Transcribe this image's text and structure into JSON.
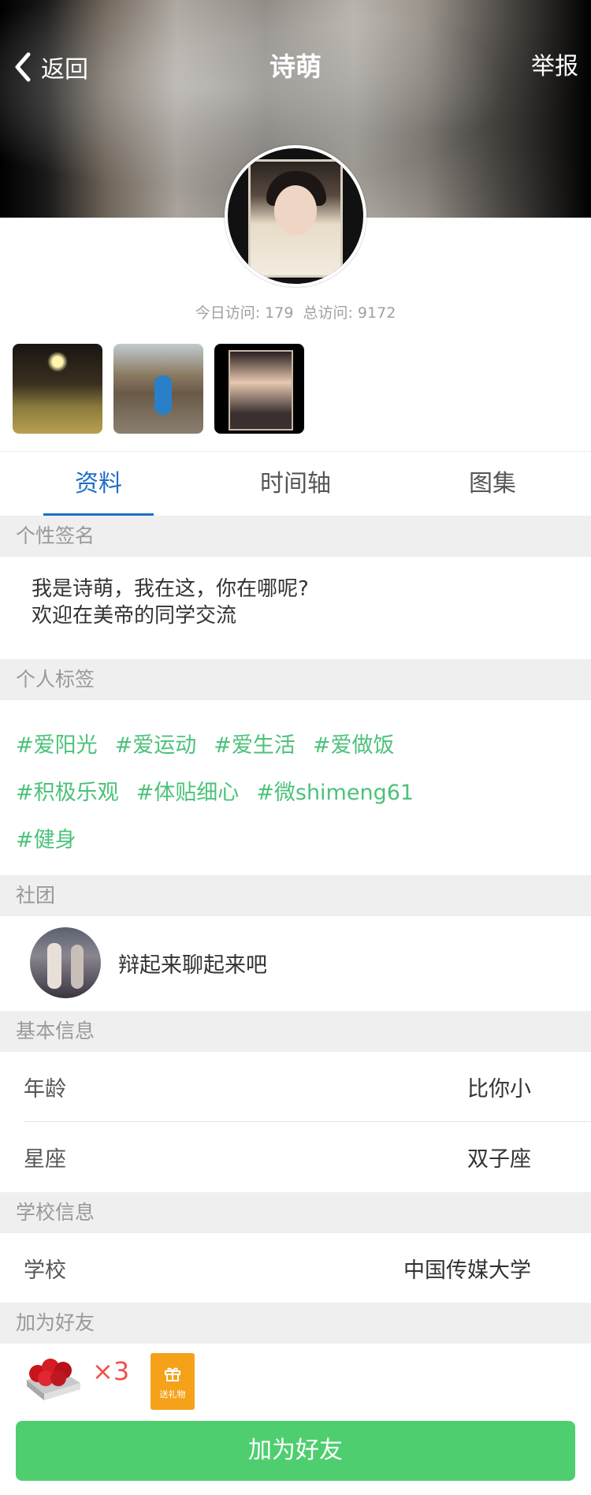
{
  "nav": {
    "back_label": "返回",
    "title": "诗萌",
    "report_label": "举报"
  },
  "visits": {
    "today": "今日访问: 179",
    "total": "总访问: 9172"
  },
  "tabs": [
    {
      "label": "资料"
    },
    {
      "label": "时间轴"
    },
    {
      "label": "图集"
    }
  ],
  "sections": {
    "signature": "个性签名",
    "tags": "个人标签",
    "club": "社团",
    "basic": "基本信息",
    "school": "学校信息",
    "add_friend": "加为好友"
  },
  "signature": {
    "line1": "我是诗萌，我在这，你在哪呢?",
    "line2": "欢迎在美帝的同学交流"
  },
  "tags": [
    "#爱阳光",
    "#爱运动",
    "#爱生活",
    "#爱做饭",
    "#积极乐观",
    "#体贴细心",
    "#微shimeng61",
    "#健身"
  ],
  "club": {
    "name": "辩起来聊起来吧"
  },
  "basic_info": [
    {
      "label": "年龄",
      "value": "比你小"
    },
    {
      "label": "星座",
      "value": "双子座"
    }
  ],
  "school_info": [
    {
      "label": "学校",
      "value": "中国传媒大学"
    }
  ],
  "gift": {
    "count": "×3",
    "button_label": "送礼物"
  },
  "add_friend_button": "加为好友",
  "colors": {
    "tab_active": "#1e6fc8",
    "tag": "#4bc27a",
    "primary_button": "#4fce70",
    "gift_button": "#f5a21a",
    "gift_count": "#f0524a"
  },
  "icons": {
    "back": "chevron-left-icon",
    "gift": "gift-icon",
    "rose": "rose-box-icon"
  }
}
